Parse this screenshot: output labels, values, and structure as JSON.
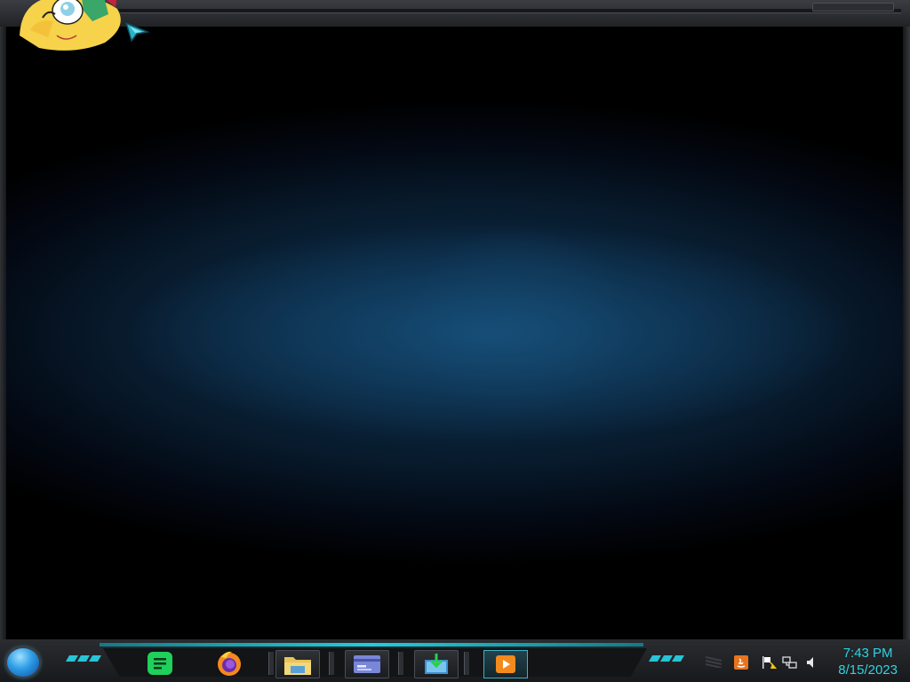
{
  "taskbar": {
    "start_button": "start-orb",
    "pinned": [
      {
        "name": "notes-app",
        "icon": "notes-icon"
      },
      {
        "name": "firefox",
        "icon": "firefox-icon"
      },
      {
        "name": "file-explorer",
        "icon": "folder-icon"
      },
      {
        "name": "card-app",
        "icon": "id-card-icon"
      },
      {
        "name": "download-app",
        "icon": "download-icon"
      },
      {
        "name": "media-player",
        "icon": "play-icon"
      }
    ],
    "accent_color": "#1dd0dc"
  },
  "tray": {
    "icons": [
      "java-icon",
      "action-center-flag-icon",
      "network-icon",
      "volume-icon"
    ],
    "time": "7:43 PM",
    "date": "8/15/2023"
  },
  "desktop": {
    "mascot": "cartoon-character-peeking-icon",
    "cursor": "teal-arrow-cursor-icon"
  }
}
